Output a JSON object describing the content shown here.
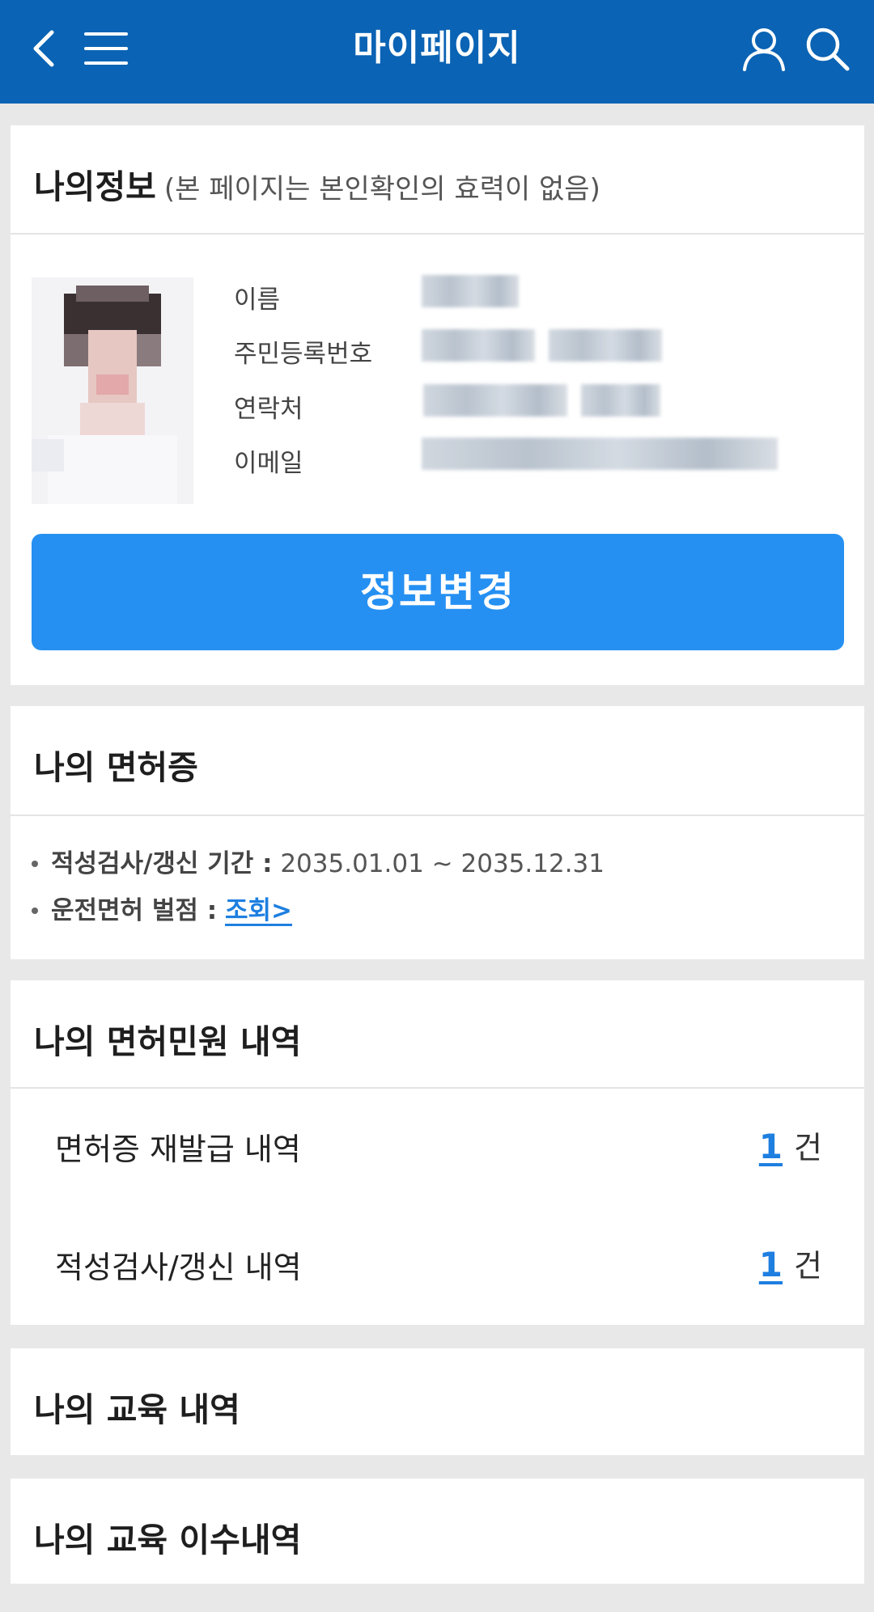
{
  "header": {
    "title": "마이페이지",
    "bg_color": "#0a63b4"
  },
  "my_info": {
    "title": "나의정보",
    "subtitle": "(본 페이지는 본인확인의 효력이 없음)",
    "fields": [
      {
        "label": "이름"
      },
      {
        "label": "주민등록번호"
      },
      {
        "label": "연락처"
      },
      {
        "label": "이메일"
      }
    ],
    "edit_button": "정보변경",
    "button_color": "#2590f2"
  },
  "license": {
    "title": "나의 면허증",
    "renewal_label": "적성검사/갱신 기간 :",
    "renewal_value": "2035.01.01 ~ 2035.12.31",
    "points_label": "운전면허 벌점 :",
    "points_link": "조회>"
  },
  "civil_history": {
    "title": "나의 면허민원 내역",
    "items": [
      {
        "label": "면허증 재발급 내역",
        "count": "1",
        "unit": "건"
      },
      {
        "label": "적성검사/갱신 내역",
        "count": "1",
        "unit": "건"
      }
    ]
  },
  "education": {
    "title": "나의 교육 내역"
  },
  "education_completion": {
    "title": "나의 교육 이수내역"
  },
  "icons": {
    "back": "chevron-left-icon",
    "menu": "hamburger-menu-icon",
    "user": "user-icon",
    "search": "search-icon"
  }
}
